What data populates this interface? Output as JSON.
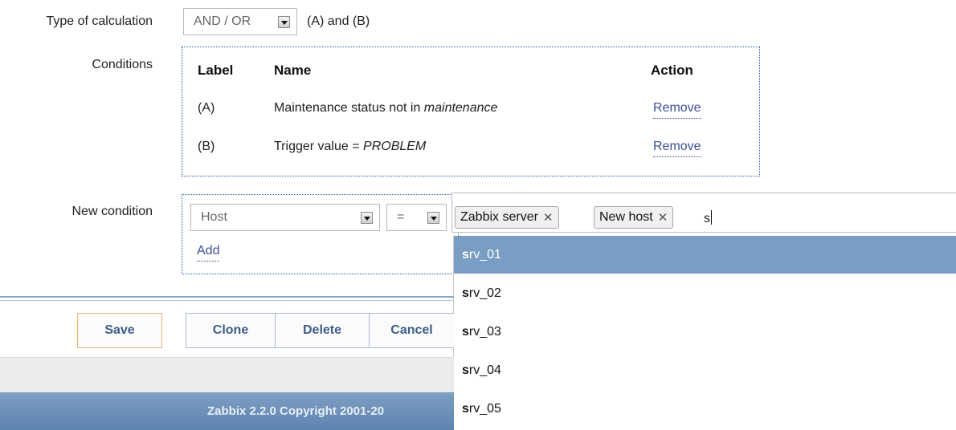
{
  "calc": {
    "label": "Type of calculation",
    "selected": "AND / OR",
    "formula": "(A) and (B)"
  },
  "conditions": {
    "label": "Conditions",
    "headers": {
      "label": "Label",
      "name": "Name",
      "action": "Action"
    },
    "rows": [
      {
        "label": "(A)",
        "name_prefix": "Maintenance status not in ",
        "name_value": "maintenance",
        "action": "Remove"
      },
      {
        "label": "(B)",
        "name_prefix": "Trigger value = ",
        "name_value": "PROBLEM",
        "action": "Remove"
      }
    ]
  },
  "new_condition": {
    "label": "New condition",
    "type_selected": "Host",
    "operator_selected": "=",
    "add_label": "Add",
    "chips": [
      {
        "label": "Zabbix server",
        "remove": "✕"
      },
      {
        "label": "New host",
        "remove": "✕"
      }
    ],
    "input_value": "s",
    "suggestions": [
      {
        "prefix": "s",
        "rest": "rv_01",
        "selected": true
      },
      {
        "prefix": "s",
        "rest": "rv_02"
      },
      {
        "prefix": "s",
        "rest": "rv_03"
      },
      {
        "prefix": "s",
        "rest": "rv_04"
      },
      {
        "prefix": "s",
        "rest": "rv_05"
      }
    ]
  },
  "buttons": {
    "save": "Save",
    "clone": "Clone",
    "delete": "Delete",
    "cancel": "Cancel"
  },
  "footer": {
    "text": "Zabbix 2.2.0 Copyright 2001-20"
  },
  "colors": {
    "accent_border": "#2d5aa8",
    "link": "#3a4f9a",
    "selected_suggestion": "#7a9dc4",
    "footer_bg": "#6b8db8",
    "save_border": "#f2b66f"
  }
}
